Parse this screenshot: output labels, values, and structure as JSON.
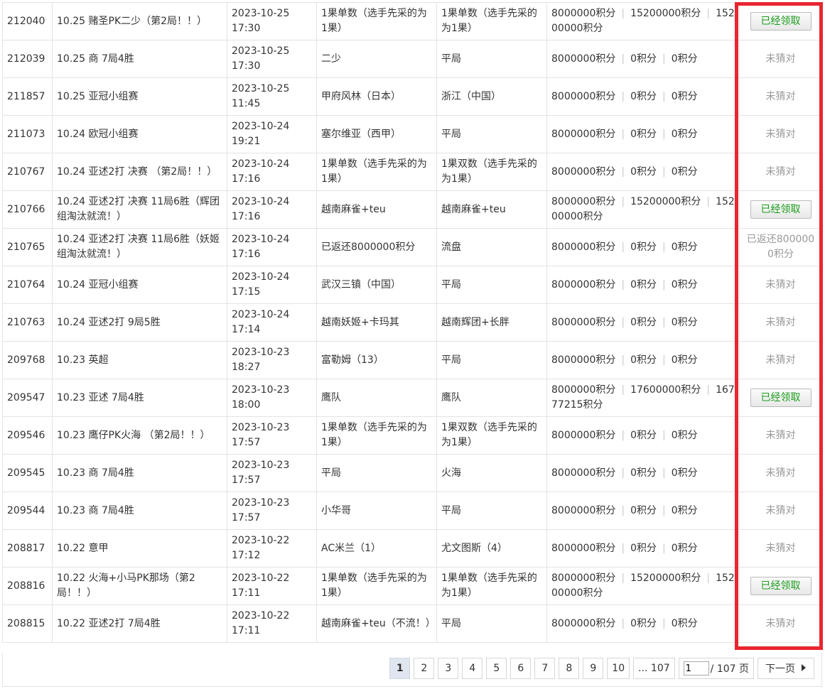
{
  "rows": [
    {
      "id": "212040",
      "name": "10.25 赌圣PK二少（第2局！！）",
      "date": "2023-10-25",
      "time": "17:30",
      "pick": "1果单数（选手先采的为1果）",
      "result": "1果单数（选手先采的为1果）",
      "stake": "8000000积分",
      "win": "15200000积分",
      "payout": "15200000积分",
      "status": "已经领取",
      "claimed": true
    },
    {
      "id": "212039",
      "name": "10.25 商 7局4胜",
      "date": "2023-10-25",
      "time": "17:30",
      "pick": "二少",
      "result": "平局",
      "stake": "8000000积分",
      "win": "0积分",
      "payout": "0积分",
      "status": "未猜对",
      "claimed": false
    },
    {
      "id": "211857",
      "name": "10.25 亚冠小组赛",
      "date": "2023-10-25",
      "time": "11:45",
      "pick": "甲府风林（日本）",
      "result": "浙江（中国）",
      "stake": "8000000积分",
      "win": "0积分",
      "payout": "0积分",
      "status": "未猜对",
      "claimed": false
    },
    {
      "id": "211073",
      "name": "10.24 欧冠小组赛",
      "date": "2023-10-24",
      "time": "19:21",
      "pick": "塞尔维亚（西甲）",
      "result": "平局",
      "stake": "8000000积分",
      "win": "0积分",
      "payout": "0积分",
      "status": "未猜对",
      "claimed": false
    },
    {
      "id": "210767",
      "name": "10.24 亚述2打 决赛 （第2局！！）",
      "date": "2023-10-24",
      "time": "17:16",
      "pick": "1果单数（选手先采的为1果）",
      "result": "1果双数（选手先采的为1果）",
      "stake": "8000000积分",
      "win": "0积分",
      "payout": "0积分",
      "status": "未猜对",
      "claimed": false
    },
    {
      "id": "210766",
      "name": "10.24 亚述2打 决赛 11局6胜（辉团组淘汰就流！）",
      "date": "2023-10-24",
      "time": "17:16",
      "pick": "越南麻雀+teu",
      "result": "越南麻雀+teu",
      "stake": "8000000积分",
      "win": "15200000积分",
      "payout": "15200000积分",
      "status": "已经领取",
      "claimed": true
    },
    {
      "id": "210765",
      "name": "10.24 亚述2打 决赛 11局6胜（妖姬组淘汰就流！）",
      "date": "2023-10-24",
      "time": "17:16",
      "pick": "已返还8000000积分",
      "result": "流盘",
      "stake": "8000000积分",
      "win": "0积分",
      "payout": "0积分",
      "status": "已返还8000000积分",
      "claimed": false
    },
    {
      "id": "210764",
      "name": "10.24 亚冠小组赛",
      "date": "2023-10-24",
      "time": "17:15",
      "pick": "武汉三镇（中国）",
      "result": "平局",
      "stake": "8000000积分",
      "win": "0积分",
      "payout": "0积分",
      "status": "未猜对",
      "claimed": false
    },
    {
      "id": "210763",
      "name": "10.24 亚述2打 9局5胜",
      "date": "2023-10-24",
      "time": "17:14",
      "pick": "越南妖姬+卡玛其",
      "result": "越南辉团+长胖",
      "stake": "8000000积分",
      "win": "0积分",
      "payout": "0积分",
      "status": "未猜对",
      "claimed": false
    },
    {
      "id": "209768",
      "name": "10.23 英超",
      "date": "2023-10-23",
      "time": "18:27",
      "pick": "富勒姆（13）",
      "result": "平局",
      "stake": "8000000积分",
      "win": "0积分",
      "payout": "0积分",
      "status": "未猜对",
      "claimed": false
    },
    {
      "id": "209547",
      "name": "10.23 亚述 7局4胜",
      "date": "2023-10-23",
      "time": "18:00",
      "pick": "鹰队",
      "result": "鹰队",
      "stake": "8000000积分",
      "win": "17600000积分",
      "payout": "16777215积分",
      "status": "已经领取",
      "claimed": true
    },
    {
      "id": "209546",
      "name": "10.23 鹰仔PK火海 （第2局！！）",
      "date": "2023-10-23",
      "time": "17:57",
      "pick": "1果单数（选手先采的为1果）",
      "result": "1果双数（选手先采的为1果）",
      "stake": "8000000积分",
      "win": "0积分",
      "payout": "0积分",
      "status": "未猜对",
      "claimed": false
    },
    {
      "id": "209545",
      "name": "10.23 商 7局4胜",
      "date": "2023-10-23",
      "time": "17:57",
      "pick": "平局",
      "result": "火海",
      "stake": "8000000积分",
      "win": "0积分",
      "payout": "0积分",
      "status": "未猜对",
      "claimed": false
    },
    {
      "id": "209544",
      "name": "10.23 商 7局4胜",
      "date": "2023-10-23",
      "time": "17:57",
      "pick": "小华哥",
      "result": "平局",
      "stake": "8000000积分",
      "win": "0积分",
      "payout": "0积分",
      "status": "未猜对",
      "claimed": false
    },
    {
      "id": "208817",
      "name": "10.22 意甲",
      "date": "2023-10-22",
      "time": "17:12",
      "pick": "AC米兰（1）",
      "result": "尤文图斯（4）",
      "stake": "8000000积分",
      "win": "0积分",
      "payout": "0积分",
      "status": "未猜对",
      "claimed": false
    },
    {
      "id": "208816",
      "name": "10.22 火海+小马PK那场（第2局！！）",
      "date": "2023-10-22",
      "time": "17:11",
      "pick": "1果单数（选手先采的为1果）",
      "result": "1果单数（选手先采的为1果）",
      "stake": "8000000积分",
      "win": "15200000积分",
      "payout": "15200000积分",
      "status": "已经领取",
      "claimed": true
    },
    {
      "id": "208815",
      "name": "10.22 亚述2打 7局4胜",
      "date": "2023-10-22",
      "time": "17:11",
      "pick": "越南麻雀+teu（不流！）",
      "result": "平局",
      "stake": "8000000积分",
      "win": "0积分",
      "payout": "0积分",
      "status": "未猜对",
      "claimed": false
    }
  ],
  "pagination": {
    "pages": [
      "1",
      "2",
      "3",
      "4",
      "5",
      "6",
      "7",
      "8",
      "9",
      "10"
    ],
    "current": "1",
    "ellipsis_last": "... 107",
    "jump_value": "1",
    "total_label": "/ 107 页",
    "next_label": "下一页",
    "next_icon": "caret-right-icon"
  },
  "colors": {
    "highlight_border": "#e8262f",
    "claimed_text": "#1a9c1a",
    "muted_text": "#999999"
  }
}
